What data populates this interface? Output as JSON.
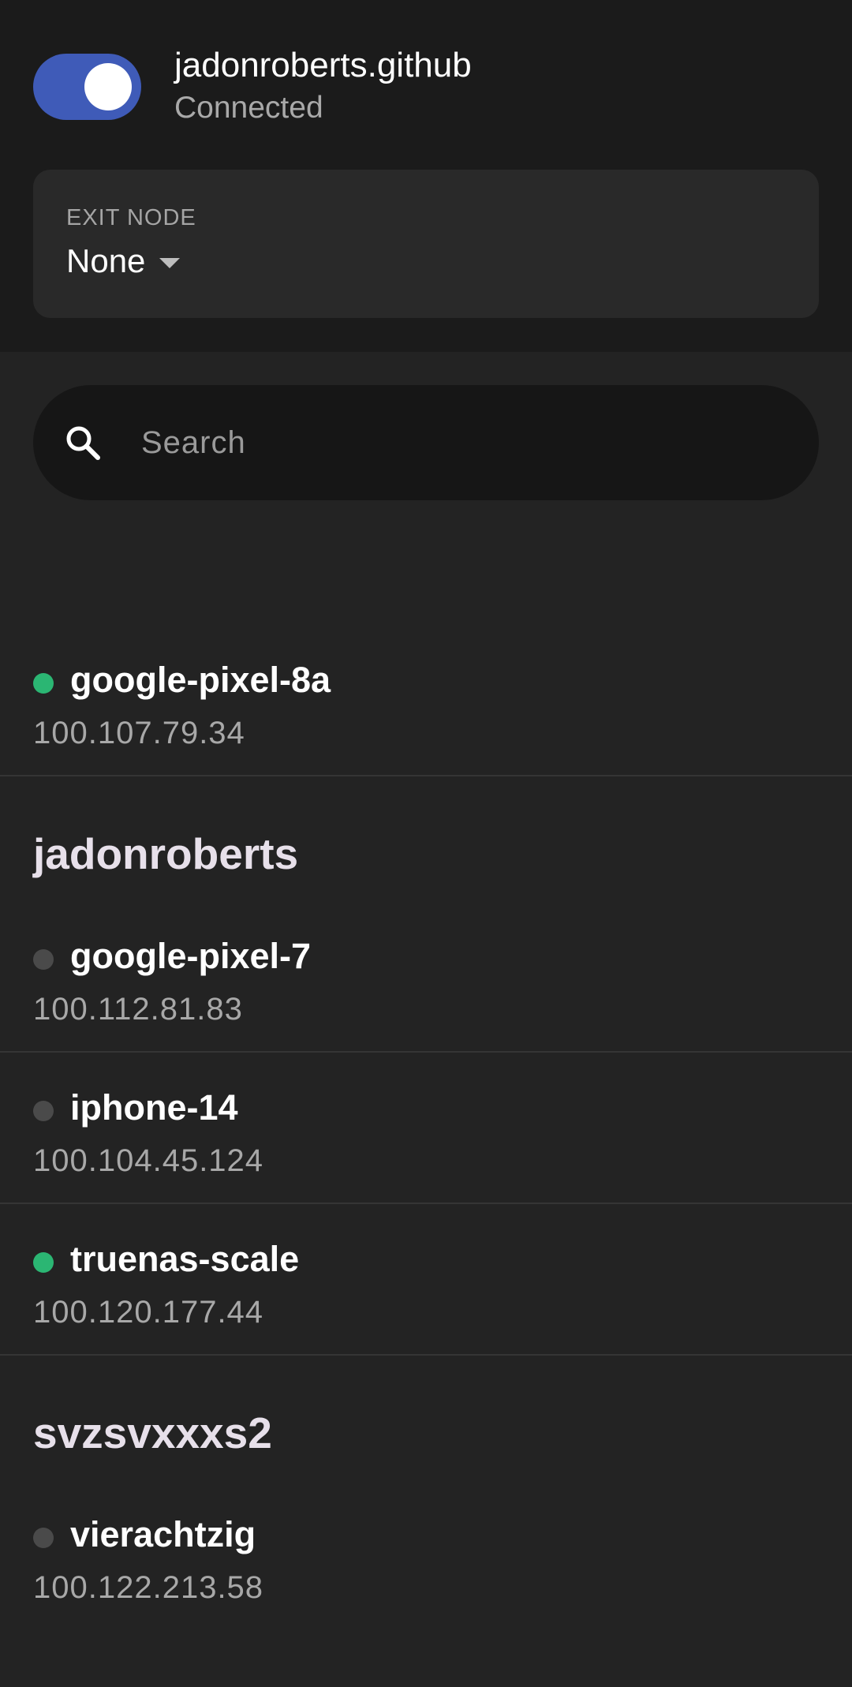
{
  "account": {
    "name": "jadonroberts.github",
    "status": "Connected",
    "toggle_on": true,
    "toggle_color": "#3f5bb8"
  },
  "exit_node": {
    "label": "EXIT NODE",
    "value": "None"
  },
  "search": {
    "placeholder": "Search"
  },
  "colors": {
    "online": "#2bb673",
    "offline": "#4a4a4a"
  },
  "devices": [
    {
      "name": "google-pixel-8a",
      "ip": "100.107.79.34",
      "online": true
    },
    {
      "name": "google-pixel-7",
      "ip": "100.112.81.83",
      "online": false
    },
    {
      "name": "iphone-14",
      "ip": "100.104.45.124",
      "online": false
    },
    {
      "name": "truenas-scale",
      "ip": "100.120.177.44",
      "online": true
    },
    {
      "name": "vierachtzig",
      "ip": "100.122.213.58",
      "online": false
    }
  ],
  "groups": [
    {
      "title": "jadonroberts"
    },
    {
      "title": "svzsvxxxs2"
    }
  ]
}
